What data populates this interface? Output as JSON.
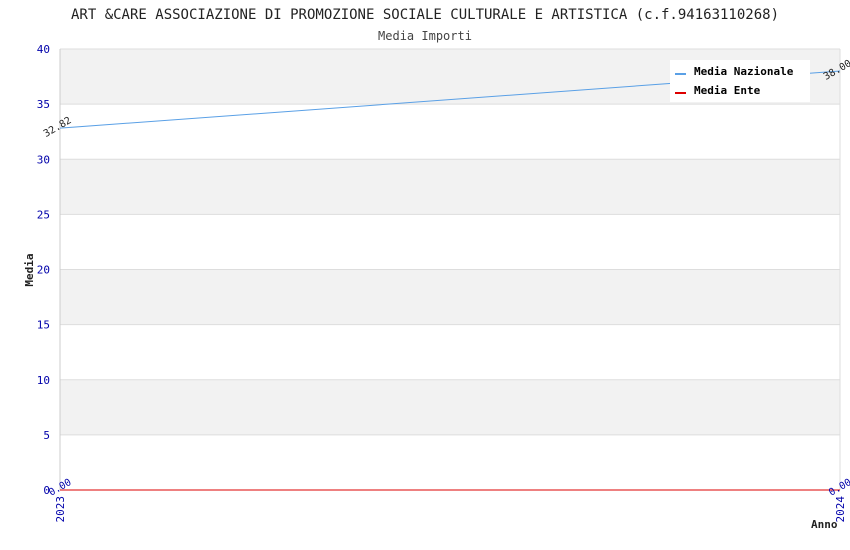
{
  "chart_data": {
    "type": "line",
    "title": "ART &CARE ASSOCIAZIONE DI PROMOZIONE SOCIALE CULTURALE E ARTISTICA (c.f.94163110268)",
    "subtitle": "Media Importi",
    "xlabel": "Anno",
    "ylabel": "Media",
    "categories": [
      "2023",
      "2024"
    ],
    "ylim": [
      0,
      40
    ],
    "yticks": [
      0,
      5,
      10,
      15,
      20,
      25,
      30,
      35,
      40
    ],
    "grid": true,
    "legend_position": "top-right",
    "series": [
      {
        "name": "Media Nazionale",
        "values": [
          32.82,
          38.0
        ],
        "labels": [
          "32.82",
          "38.00"
        ],
        "color": "#5aa0e6"
      },
      {
        "name": "Media Ente",
        "values": [
          0.0,
          0.0
        ],
        "labels": [
          "0.00",
          "0.00"
        ],
        "color": "#dd0000"
      }
    ]
  }
}
